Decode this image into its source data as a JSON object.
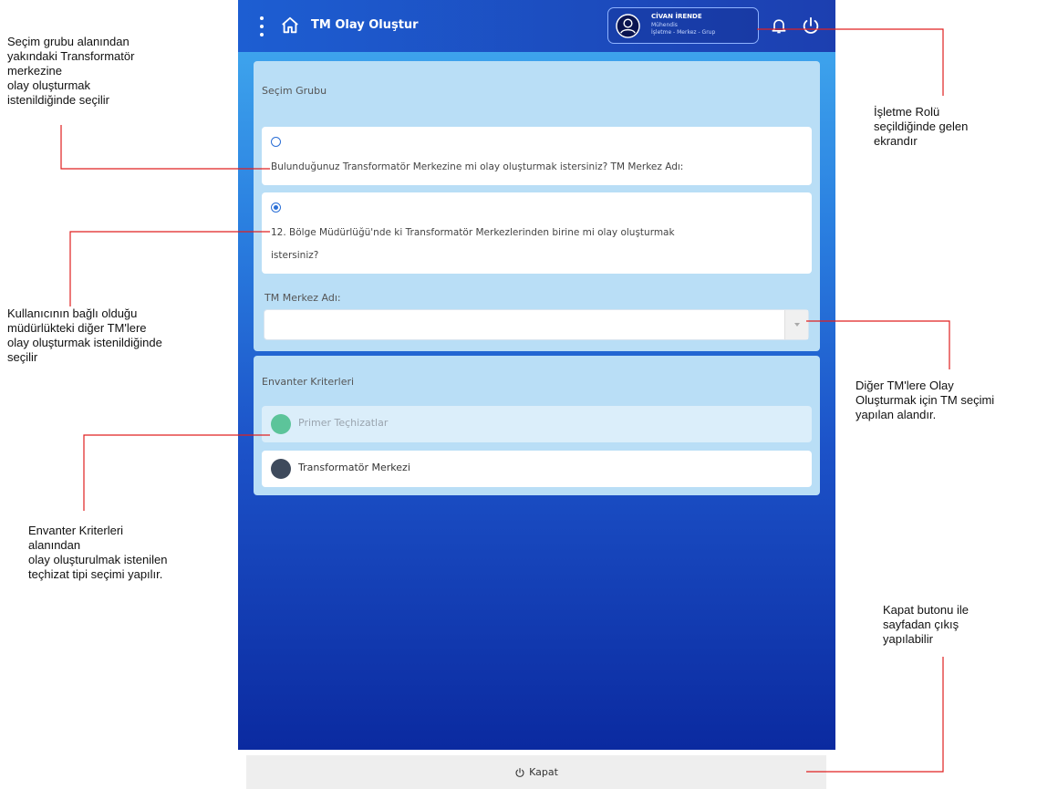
{
  "app": {
    "title": "TM Olay Oluştur",
    "user_name": "CİVAN İRENDE",
    "user_role": "Mühendis",
    "user_dept": "İşletme - Merkez - Grup"
  },
  "selection_group": {
    "title": "Seçim Grubu",
    "option1": {
      "text": "Bulunduğunuz Transformatör Merkezine mi olay oluşturmak istersiniz? TM Merkez Adı:",
      "checked": false
    },
    "option2": {
      "line1": "12. Bölge Müdürlüğü'nde ki Transformatör Merkezlerinden birine mi olay oluşturmak",
      "line2": "istersiniz?",
      "checked": true
    },
    "tm_label": "TM Merkez Adı:",
    "tm_value": ""
  },
  "inventory": {
    "title": "Envanter Kriterleri",
    "items": [
      {
        "label": "Primer Teçhizatlar",
        "color": "#5cc49a",
        "selected": true
      },
      {
        "label": "Transformatör Merkezi",
        "color": "#3e4a5c",
        "selected": false
      }
    ]
  },
  "footer": {
    "close_label": "Kapat"
  },
  "annotations": {
    "n1": [
      "Seçim grubu alanından",
      "yakındaki Transformatör",
      "merkezine",
      "olay oluşturmak",
      "istenildiğinde seçilir"
    ],
    "n2": [
      "Kullanıcının bağlı olduğu",
      "müdürlükteki diğer TM'lere",
      "olay oluşturmak istenildiğinde",
      "seçilir"
    ],
    "n3": [
      "Envanter Kriterleri",
      "alanından",
      "olay oluşturulmak istenilen",
      "teçhizat tipi seçimi yapılır."
    ],
    "n4": [
      "İşletme Rolü",
      "seçildiğinde gelen",
      "ekrandır"
    ],
    "n5": [
      "Diğer TM'lere Olay",
      "Oluşturmak için TM seçimi",
      "yapılan alandır."
    ],
    "n6": [
      "Kapat butonu ile",
      "sayfadan çıkış",
      "yapılabilir"
    ]
  },
  "colors": {
    "accent": "#2b6fd6",
    "annotation_line": "#e02020"
  }
}
